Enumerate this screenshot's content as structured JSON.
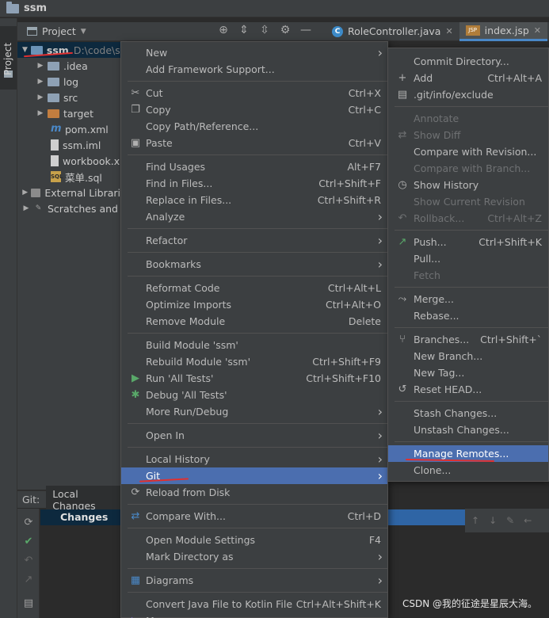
{
  "window": {
    "title": "ssm"
  },
  "toolstrip": {
    "project_tab": "Project"
  },
  "project_panel": {
    "header": "Project",
    "tree": [
      {
        "label": "ssm",
        "extra": "D:\\code\\ss",
        "kind": "module",
        "expanded": true,
        "selected": true
      },
      {
        "label": ".idea",
        "kind": "folder"
      },
      {
        "label": "log",
        "kind": "folder"
      },
      {
        "label": "src",
        "kind": "folder"
      },
      {
        "label": "target",
        "kind": "folder-excluded"
      },
      {
        "label": "pom.xml",
        "kind": "maven"
      },
      {
        "label": "ssm.iml",
        "kind": "iml"
      },
      {
        "label": "workbook.x",
        "kind": "xls"
      },
      {
        "label": "菜单.sql",
        "kind": "sql"
      },
      {
        "label": "External Librari",
        "kind": "lib"
      },
      {
        "label": "Scratches and",
        "kind": "scratch"
      }
    ]
  },
  "editor_tabs": [
    {
      "label": "RoleController.java",
      "icon": "class-icon"
    },
    {
      "label": "index.jsp",
      "icon": "jsp-icon",
      "active": true
    }
  ],
  "git_panel": {
    "prefix": "Git:",
    "tab": "Local Changes",
    "changes_label": "Changes"
  },
  "context_menu": [
    {
      "label": "New",
      "submenu": true
    },
    {
      "label": "Add Framework Support..."
    },
    {
      "sep": true
    },
    {
      "label": "Cut",
      "shortcut": "Ctrl+X",
      "icon": "cut-icon"
    },
    {
      "label": "Copy",
      "shortcut": "Ctrl+C",
      "icon": "copy-icon"
    },
    {
      "label": "Copy Path/Reference..."
    },
    {
      "label": "Paste",
      "shortcut": "Ctrl+V",
      "icon": "paste-icon"
    },
    {
      "sep": true
    },
    {
      "label": "Find Usages",
      "shortcut": "Alt+F7"
    },
    {
      "label": "Find in Files...",
      "shortcut": "Ctrl+Shift+F"
    },
    {
      "label": "Replace in Files...",
      "shortcut": "Ctrl+Shift+R"
    },
    {
      "label": "Analyze",
      "submenu": true
    },
    {
      "sep": true
    },
    {
      "label": "Refactor",
      "submenu": true
    },
    {
      "sep": true
    },
    {
      "label": "Bookmarks",
      "submenu": true
    },
    {
      "sep": true
    },
    {
      "label": "Reformat Code",
      "shortcut": "Ctrl+Alt+L"
    },
    {
      "label": "Optimize Imports",
      "shortcut": "Ctrl+Alt+O"
    },
    {
      "label": "Remove Module",
      "shortcut": "Delete"
    },
    {
      "sep": true
    },
    {
      "label": "Build Module 'ssm'"
    },
    {
      "label": "Rebuild Module 'ssm'",
      "shortcut": "Ctrl+Shift+F9"
    },
    {
      "label": "Run 'All Tests'",
      "shortcut": "Ctrl+Shift+F10",
      "icon": "run-icon"
    },
    {
      "label": "Debug 'All Tests'",
      "icon": "debug-icon"
    },
    {
      "label": "More Run/Debug",
      "submenu": true
    },
    {
      "sep": true
    },
    {
      "label": "Open In",
      "submenu": true
    },
    {
      "sep": true
    },
    {
      "label": "Local History",
      "submenu": true
    },
    {
      "label": "Git",
      "submenu": true,
      "highlighted": true
    },
    {
      "label": "Reload from Disk",
      "icon": "reload-icon"
    },
    {
      "sep": true
    },
    {
      "label": "Compare With...",
      "shortcut": "Ctrl+D",
      "icon": "compare-icon"
    },
    {
      "sep": true
    },
    {
      "label": "Open Module Settings",
      "shortcut": "F4"
    },
    {
      "label": "Mark Directory as",
      "submenu": true
    },
    {
      "sep": true
    },
    {
      "label": "Diagrams",
      "submenu": true,
      "icon": "diagram-icon"
    },
    {
      "sep": true
    },
    {
      "label": "Convert Java File to Kotlin File",
      "shortcut": "Ctrl+Alt+Shift+K"
    },
    {
      "label": "M",
      "icon": "kotlin-icon"
    }
  ],
  "git_submenu": [
    {
      "label": "Commit Directory..."
    },
    {
      "label": "Add",
      "shortcut": "Ctrl+Alt+A",
      "icon": "plus-icon"
    },
    {
      "label": ".git/info/exclude",
      "icon": "file-icon"
    },
    {
      "sep": true
    },
    {
      "label": "Annotate",
      "disabled": true
    },
    {
      "label": "Show Diff",
      "disabled": true,
      "icon": "diff-icon"
    },
    {
      "label": "Compare with Revision..."
    },
    {
      "label": "Compare with Branch...",
      "disabled": true
    },
    {
      "label": "Show History",
      "icon": "clock-icon"
    },
    {
      "label": "Show Current Revision",
      "disabled": true
    },
    {
      "label": "Rollback...",
      "shortcut": "Ctrl+Alt+Z",
      "disabled": true,
      "icon": "rollback-icon"
    },
    {
      "sep": true
    },
    {
      "label": "Push...",
      "shortcut": "Ctrl+Shift+K",
      "icon": "push-icon"
    },
    {
      "label": "Pull..."
    },
    {
      "label": "Fetch",
      "disabled": true
    },
    {
      "sep": true
    },
    {
      "label": "Merge...",
      "icon": "merge-icon"
    },
    {
      "label": "Rebase..."
    },
    {
      "sep": true
    },
    {
      "label": "Branches...",
      "shortcut": "Ctrl+Shift+`",
      "icon": "branch-icon"
    },
    {
      "label": "New Branch..."
    },
    {
      "label": "New Tag..."
    },
    {
      "label": "Reset HEAD...",
      "icon": "reset-icon"
    },
    {
      "sep": true
    },
    {
      "label": "Stash Changes..."
    },
    {
      "label": "Unstash Changes..."
    },
    {
      "sep": true
    },
    {
      "label": "Manage Remotes...",
      "highlighted": true
    },
    {
      "label": "Clone..."
    }
  ],
  "watermark": "CSDN @我的征途是星辰大海。"
}
